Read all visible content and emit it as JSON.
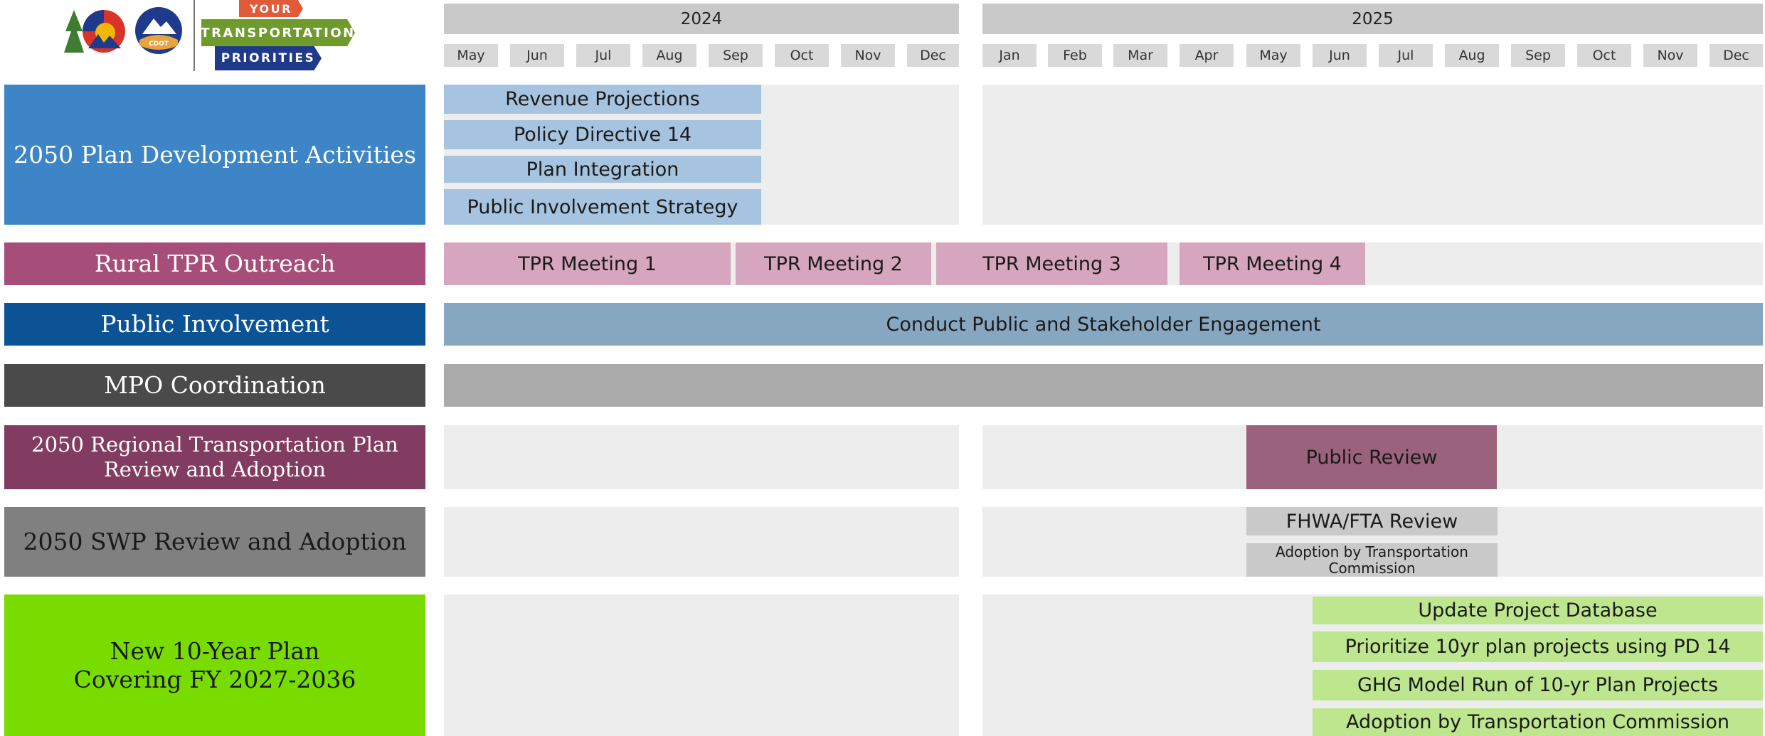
{
  "logo": {
    "line1": "YOUR",
    "line2": "TRANSPORTATION",
    "line3": "PRIORITIES",
    "badge": "CDOT",
    "colors": {
      "red": "#e15a3a",
      "green": "#6f9a2c",
      "navy": "#1f3a8a"
    }
  },
  "timeline": {
    "years": [
      "2024",
      "2025"
    ],
    "months_2024": [
      "May",
      "Jun",
      "Jul",
      "Aug",
      "Sep",
      "Oct",
      "Nov",
      "Dec"
    ],
    "months_2025": [
      "Jan",
      "Feb",
      "Mar",
      "Apr",
      "May",
      "Jun",
      "Jul",
      "Aug",
      "Sep",
      "Oct",
      "Nov",
      "Dec"
    ]
  },
  "rows": [
    {
      "label": [
        "2050 Plan Development Activities"
      ],
      "color": "#3d85c6",
      "bars": [
        {
          "text": [
            "Revenue Projections"
          ],
          "color": "#a6c4e0"
        },
        {
          "text": [
            "Policy Directive 14"
          ],
          "color": "#a6c4e0"
        },
        {
          "text": [
            "Plan Integration"
          ],
          "color": "#a6c4e0"
        },
        {
          "text": [
            "Public Involvement Strategy"
          ],
          "color": "#a6c4e0"
        }
      ]
    },
    {
      "label": [
        "Rural TPR Outreach"
      ],
      "color": "#a64d79",
      "bars": [
        {
          "text": [
            "TPR Meeting 1"
          ],
          "color": "#d5a6bd"
        },
        {
          "text": [
            "TPR Meeting 2"
          ],
          "color": "#d5a6bd"
        },
        {
          "text": [
            "TPR Meeting 3"
          ],
          "color": "#d5a6bd"
        },
        {
          "text": [
            "TPR Meeting 4"
          ],
          "color": "#d5a6bd"
        }
      ]
    },
    {
      "label": [
        "Public Involvement"
      ],
      "color": "#0b5394",
      "bars": [
        {
          "text": [
            "Conduct Public and Stakeholder Engagement"
          ],
          "color": "#87a7c1"
        }
      ]
    },
    {
      "label": [
        "MPO Coordination"
      ],
      "color": "#4a4a4a",
      "bars": [
        {
          "text": [
            ""
          ],
          "color": "#ababab"
        }
      ]
    },
    {
      "label": [
        "2050 Regional Transportation Plan",
        "Review and Adoption"
      ],
      "color": "#823c61",
      "bars": [
        {
          "text": [
            "Public Review"
          ],
          "color": "#9a627c"
        }
      ]
    },
    {
      "label": [
        "2050 SWP Review and Adoption"
      ],
      "color": "#808080",
      "bars": [
        {
          "text": [
            "FHWA/FTA Review"
          ],
          "color": "#c9c9c9"
        },
        {
          "text": [
            "Adoption by Transportation",
            "Commission"
          ],
          "color": "#c9c9c9"
        }
      ]
    },
    {
      "label": [
        "New 10-Year Plan",
        "Covering FY 2027-2036"
      ],
      "color": "#78dc00",
      "label_text_color": "#1a1a1a",
      "bars": [
        {
          "text": [
            "Update Project Database"
          ],
          "color": "#bde68e"
        },
        {
          "text": [
            "Prioritize 10yr plan projects using PD 14"
          ],
          "color": "#bde68e"
        },
        {
          "text": [
            "GHG Model Run of 10-yr Plan Projects"
          ],
          "color": "#bde68e"
        },
        {
          "text": [
            "Adoption by Transportation Commission"
          ],
          "color": "#bde68e"
        }
      ]
    }
  ]
}
